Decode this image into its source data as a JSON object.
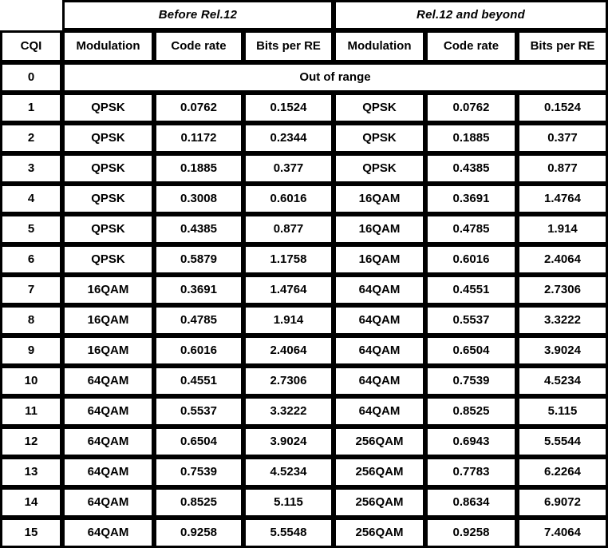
{
  "table": {
    "group_headers": [
      {
        "label": "",
        "span": 1,
        "blank": true
      },
      {
        "label": "Before Rel.12",
        "span": 3
      },
      {
        "label": "Rel.12 and beyond",
        "span": 3
      }
    ],
    "column_headers": [
      "CQI",
      "Modulation",
      "Code rate",
      "Bits per RE",
      "Modulation",
      "Code rate",
      "Bits per RE"
    ],
    "out_of_range_row": {
      "cqi": "0",
      "label": "Out of range"
    },
    "colors": {
      "plain_fill": "#ffffff",
      "plain_text": "#000000",
      "blue_fill": "#c3d4ea",
      "blue_text": "#1f3864",
      "green_fill": "#d8e3c0",
      "green_text": "#4d6125",
      "orange_fill": "#fce9dc",
      "orange_text": "#e8681b",
      "border": "#000000"
    },
    "rows": [
      {
        "cqi": "1",
        "left": {
          "modulation": "QPSK",
          "code_rate": "0.0762",
          "bits_per_re": "0.1524",
          "style": "plain"
        },
        "right": {
          "modulation": "QPSK",
          "code_rate": "0.0762",
          "bits_per_re": "0.1524",
          "style": "plain"
        }
      },
      {
        "cqi": "2",
        "left": {
          "modulation": "QPSK",
          "code_rate": "0.1172",
          "bits_per_re": "0.2344",
          "style": "plain"
        },
        "right": {
          "modulation": "QPSK",
          "code_rate": "0.1885",
          "bits_per_re": "0.377",
          "style": "plain"
        }
      },
      {
        "cqi": "3",
        "left": {
          "modulation": "QPSK",
          "code_rate": "0.1885",
          "bits_per_re": "0.377",
          "style": "plain"
        },
        "right": {
          "modulation": "QPSK",
          "code_rate": "0.4385",
          "bits_per_re": "0.877",
          "style": "plain"
        }
      },
      {
        "cqi": "4",
        "left": {
          "modulation": "QPSK",
          "code_rate": "0.3008",
          "bits_per_re": "0.6016",
          "style": "plain"
        },
        "right": {
          "modulation": "16QAM",
          "code_rate": "0.3691",
          "bits_per_re": "1.4764",
          "style": "blue"
        }
      },
      {
        "cqi": "5",
        "left": {
          "modulation": "QPSK",
          "code_rate": "0.4385",
          "bits_per_re": "0.877",
          "style": "plain"
        },
        "right": {
          "modulation": "16QAM",
          "code_rate": "0.4785",
          "bits_per_re": "1.914",
          "style": "blue"
        }
      },
      {
        "cqi": "6",
        "left": {
          "modulation": "QPSK",
          "code_rate": "0.5879",
          "bits_per_re": "1.1758",
          "style": "plain"
        },
        "right": {
          "modulation": "16QAM",
          "code_rate": "0.6016",
          "bits_per_re": "2.4064",
          "style": "blue"
        }
      },
      {
        "cqi": "7",
        "cqi_style": "blue",
        "left": {
          "modulation": "16QAM",
          "code_rate": "0.3691",
          "bits_per_re": "1.4764",
          "style": "blue"
        },
        "right": {
          "modulation": "64QAM",
          "code_rate": "0.4551",
          "bits_per_re": "2.7306",
          "style": "green"
        }
      },
      {
        "cqi": "8",
        "cqi_style": "blue",
        "left": {
          "modulation": "16QAM",
          "code_rate": "0.4785",
          "bits_per_re": "1.914",
          "style": "blue"
        },
        "right": {
          "modulation": "64QAM",
          "code_rate": "0.5537",
          "bits_per_re": "3.3222",
          "style": "green"
        }
      },
      {
        "cqi": "9",
        "cqi_style": "blue",
        "left": {
          "modulation": "16QAM",
          "code_rate": "0.6016",
          "bits_per_re": "2.4064",
          "style": "blue"
        },
        "right": {
          "modulation": "64QAM",
          "code_rate": "0.6504",
          "bits_per_re": "3.9024",
          "style": "green"
        }
      },
      {
        "cqi": "10",
        "cqi_style": "green",
        "left": {
          "modulation": "64QAM",
          "code_rate": "0.4551",
          "bits_per_re": "2.7306",
          "style": "green"
        },
        "right": {
          "modulation": "64QAM",
          "code_rate": "0.7539",
          "bits_per_re": "4.5234",
          "style": "green"
        }
      },
      {
        "cqi": "11",
        "cqi_style": "green",
        "left": {
          "modulation": "64QAM",
          "code_rate": "0.5537",
          "bits_per_re": "3.3222",
          "style": "green"
        },
        "right": {
          "modulation": "64QAM",
          "code_rate": "0.8525",
          "bits_per_re": "5.115",
          "style": "green"
        }
      },
      {
        "cqi": "12",
        "cqi_style": "green",
        "left": {
          "modulation": "64QAM",
          "code_rate": "0.6504",
          "bits_per_re": "3.9024",
          "style": "green"
        },
        "right": {
          "modulation": "256QAM",
          "code_rate": "0.6943",
          "bits_per_re": "5.5544",
          "style": "orange"
        }
      },
      {
        "cqi": "13",
        "cqi_style": "green",
        "left": {
          "modulation": "64QAM",
          "code_rate": "0.7539",
          "bits_per_re": "4.5234",
          "style": "green"
        },
        "right": {
          "modulation": "256QAM",
          "code_rate": "0.7783",
          "bits_per_re": "6.2264",
          "style": "orange"
        }
      },
      {
        "cqi": "14",
        "cqi_style": "green",
        "left": {
          "modulation": "64QAM",
          "code_rate": "0.8525",
          "bits_per_re": "5.115",
          "style": "green"
        },
        "right": {
          "modulation": "256QAM",
          "code_rate": "0.8634",
          "bits_per_re": "6.9072",
          "style": "orange"
        }
      },
      {
        "cqi": "15",
        "cqi_style": "green",
        "left": {
          "modulation": "64QAM",
          "code_rate": "0.9258",
          "bits_per_re": "5.5548",
          "style": "green"
        },
        "right": {
          "modulation": "256QAM",
          "code_rate": "0.9258",
          "bits_per_re": "7.4064",
          "style": "orange"
        }
      }
    ]
  }
}
